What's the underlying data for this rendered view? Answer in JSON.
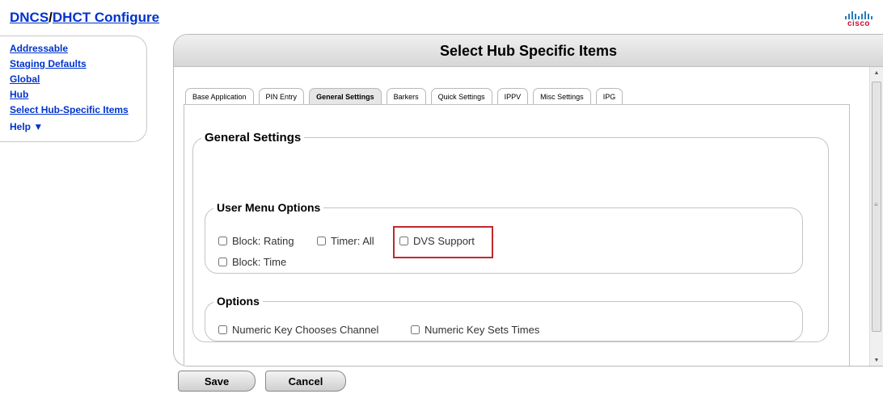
{
  "app_title": {
    "part1": "DNCS",
    "separator": "/",
    "part2": "DHCT Configure"
  },
  "logo": {
    "text": "cisco"
  },
  "sidebar": {
    "items": [
      {
        "label": "Addressable"
      },
      {
        "label": "Staging Defaults"
      },
      {
        "label": "Global"
      },
      {
        "label": "Hub"
      },
      {
        "label": "Select Hub-Specific Items"
      }
    ],
    "help_label": "Help ▼"
  },
  "panel": {
    "title": "Select Hub Specific Items"
  },
  "tabs": [
    {
      "label": "Base Application"
    },
    {
      "label": "PIN Entry"
    },
    {
      "label": "General Settings",
      "active": true
    },
    {
      "label": "Barkers"
    },
    {
      "label": "Quick Settings"
    },
    {
      "label": "IPPV"
    },
    {
      "label": "Misc Settings"
    },
    {
      "label": "IPG"
    }
  ],
  "general_settings": {
    "legend": "General Settings",
    "user_menu_options": {
      "legend": "User Menu Options",
      "checkboxes": [
        {
          "label": "Block: Rating",
          "checked": false
        },
        {
          "label": "Timer: All",
          "checked": false
        },
        {
          "label": "DVS Support",
          "checked": false,
          "highlighted": true
        },
        {
          "label": "Block: Time",
          "checked": false
        }
      ]
    },
    "options": {
      "legend": "Options",
      "checkboxes": [
        {
          "label": "Numeric Key Chooses Channel",
          "checked": false
        },
        {
          "label": "Numeric Key Sets Times",
          "checked": false
        }
      ]
    }
  },
  "buttons": {
    "save": "Save",
    "cancel": "Cancel"
  },
  "colors": {
    "link": "#0033cc",
    "highlight": "#c0282e",
    "brand_red": "#c8102e",
    "brand_blue": "#2b7bb9"
  }
}
